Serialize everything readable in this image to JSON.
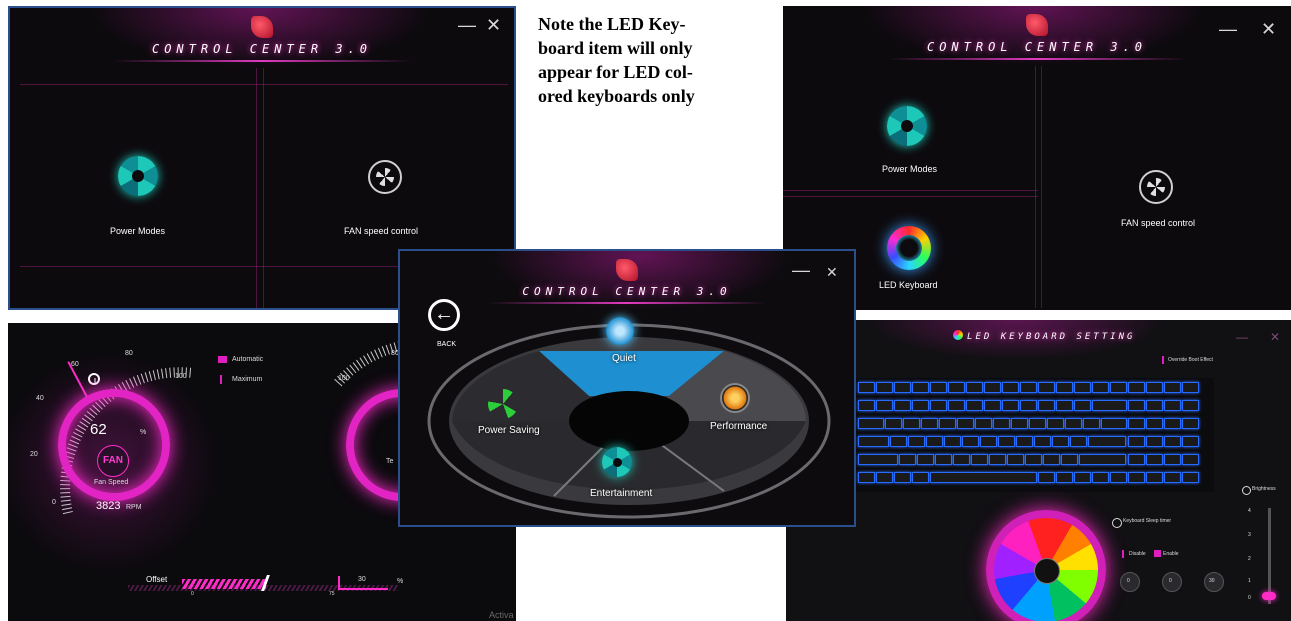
{
  "note": {
    "line1": "Note the LED Key-",
    "line2": "board item will only",
    "line3": "appear for LED col-",
    "line4": "ored keyboards only"
  },
  "window_controls": {
    "minimize": "—",
    "close": "✕"
  },
  "app": {
    "title": "CONTROL CENTER 3.0"
  },
  "main_window_a": {
    "tiles": [
      {
        "label": "Power Modes",
        "icon": "aperture-icon"
      },
      {
        "label": "FAN speed control",
        "icon": "fan-icon"
      }
    ]
  },
  "main_window_b": {
    "tiles": [
      {
        "label": "Power Modes",
        "icon": "aperture-icon"
      },
      {
        "label": "FAN speed control",
        "icon": "fan-icon"
      },
      {
        "label": "LED Keyboard",
        "icon": "led-ring-icon"
      }
    ]
  },
  "fan_panel": {
    "ticks": [
      "0",
      "20",
      "40",
      "60",
      "80",
      "100"
    ],
    "percent": "62",
    "percent_unit": "%",
    "fan_badge": "FAN",
    "fan_label": "Fan Speed",
    "rpm_value": "3823",
    "rpm_unit": "RPM",
    "options": [
      "Automatic",
      "Maximum"
    ],
    "offset_label": "Offset",
    "offset_ticks": [
      "0",
      "75"
    ],
    "offset_value": "30",
    "offset_unit": "%",
    "second_gauge_ticks": [
      "80",
      "100"
    ],
    "second_gauge_label": "Te",
    "watermark": "Activa",
    "colors": {
      "accent": "#e224c4"
    }
  },
  "power_modes": {
    "back_label": "BACK",
    "modes": [
      "Quiet",
      "Power Saving",
      "Performance",
      "Entertainment"
    ],
    "selected": "Quiet",
    "colors": {
      "selected": "#1e8fd0"
    }
  },
  "led_panel": {
    "title": "LED KEYBOARD SETTING",
    "override_label": "Override Boot Effect",
    "brightness_label": "Brightness",
    "brightness_scale": [
      "4",
      "3",
      "2",
      "1",
      "0"
    ],
    "sleep_timer_label": "Keyboard Sleep timer",
    "disable_label": "Disable",
    "enable_label": "Enable",
    "timers": [
      "0",
      "0",
      "30"
    ],
    "colors": {
      "key_glow": "#2a6bff"
    }
  }
}
